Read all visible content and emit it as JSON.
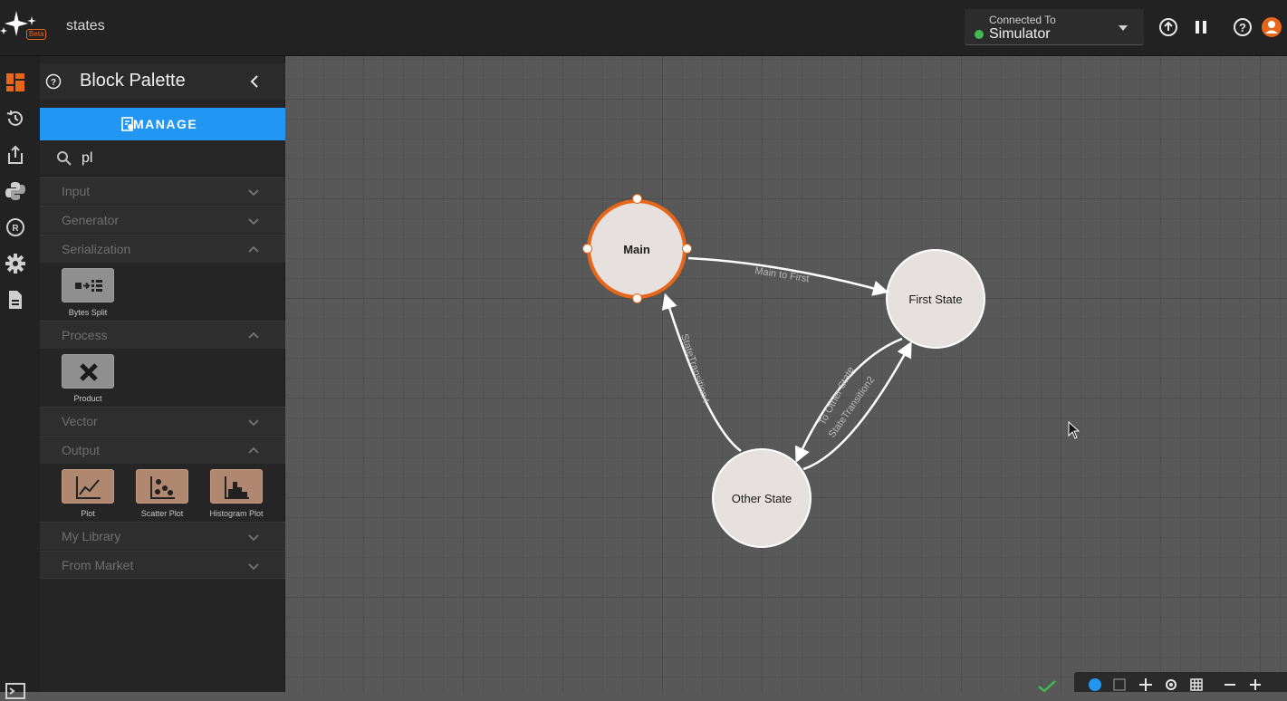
{
  "app": {
    "title": "states",
    "beta_badge": "Beta"
  },
  "connection": {
    "label": "Connected To",
    "value": "Simulator",
    "status_color": "#3fb950"
  },
  "toolbar": {
    "icons": [
      "upload-circle-icon",
      "pause-icon",
      "help-icon",
      "user-avatar-icon"
    ]
  },
  "rail": {
    "items": [
      "dashboard-icon",
      "history-icon",
      "export-icon",
      "python-icon",
      "registry-icon",
      "settings-icon",
      "document-icon"
    ]
  },
  "palette": {
    "title": "Block Palette",
    "manage_label": "MANAGE",
    "search_value": "pl",
    "categories": [
      {
        "label": "Input",
        "expanded": false
      },
      {
        "label": "Generator",
        "expanded": false
      },
      {
        "label": "Serialization",
        "expanded": true,
        "blocks": [
          {
            "label": "Bytes Split",
            "icon": "bytes-split-icon"
          }
        ]
      },
      {
        "label": "Process",
        "expanded": true,
        "blocks": [
          {
            "label": "Product",
            "icon": "close-x-icon"
          }
        ]
      },
      {
        "label": "Vector",
        "expanded": false
      },
      {
        "label": "Output",
        "expanded": true,
        "blocks": [
          {
            "label": "Plot",
            "icon": "line-chart-icon"
          },
          {
            "label": "Scatter Plot",
            "icon": "scatter-icon"
          },
          {
            "label": "Histogram Plot",
            "icon": "histogram-icon"
          }
        ]
      },
      {
        "label": "My Library",
        "expanded": false
      },
      {
        "label": "From Market",
        "expanded": false
      }
    ]
  },
  "graph": {
    "nodes": [
      {
        "id": "main",
        "label": "Main",
        "selected": true
      },
      {
        "id": "first",
        "label": "First State",
        "selected": false
      },
      {
        "id": "other",
        "label": "Other State",
        "selected": false
      }
    ],
    "edges": [
      {
        "label": "Main to First",
        "from": "Main",
        "to": "First State"
      },
      {
        "label": "To Other State",
        "from": "First State",
        "to": "Other State"
      },
      {
        "label": "StateTransition2",
        "from": "Other State",
        "to": "First State"
      },
      {
        "label": "StateTransition4",
        "from": "Other State",
        "to": "Main"
      }
    ],
    "accent_color": "#e8661a"
  }
}
